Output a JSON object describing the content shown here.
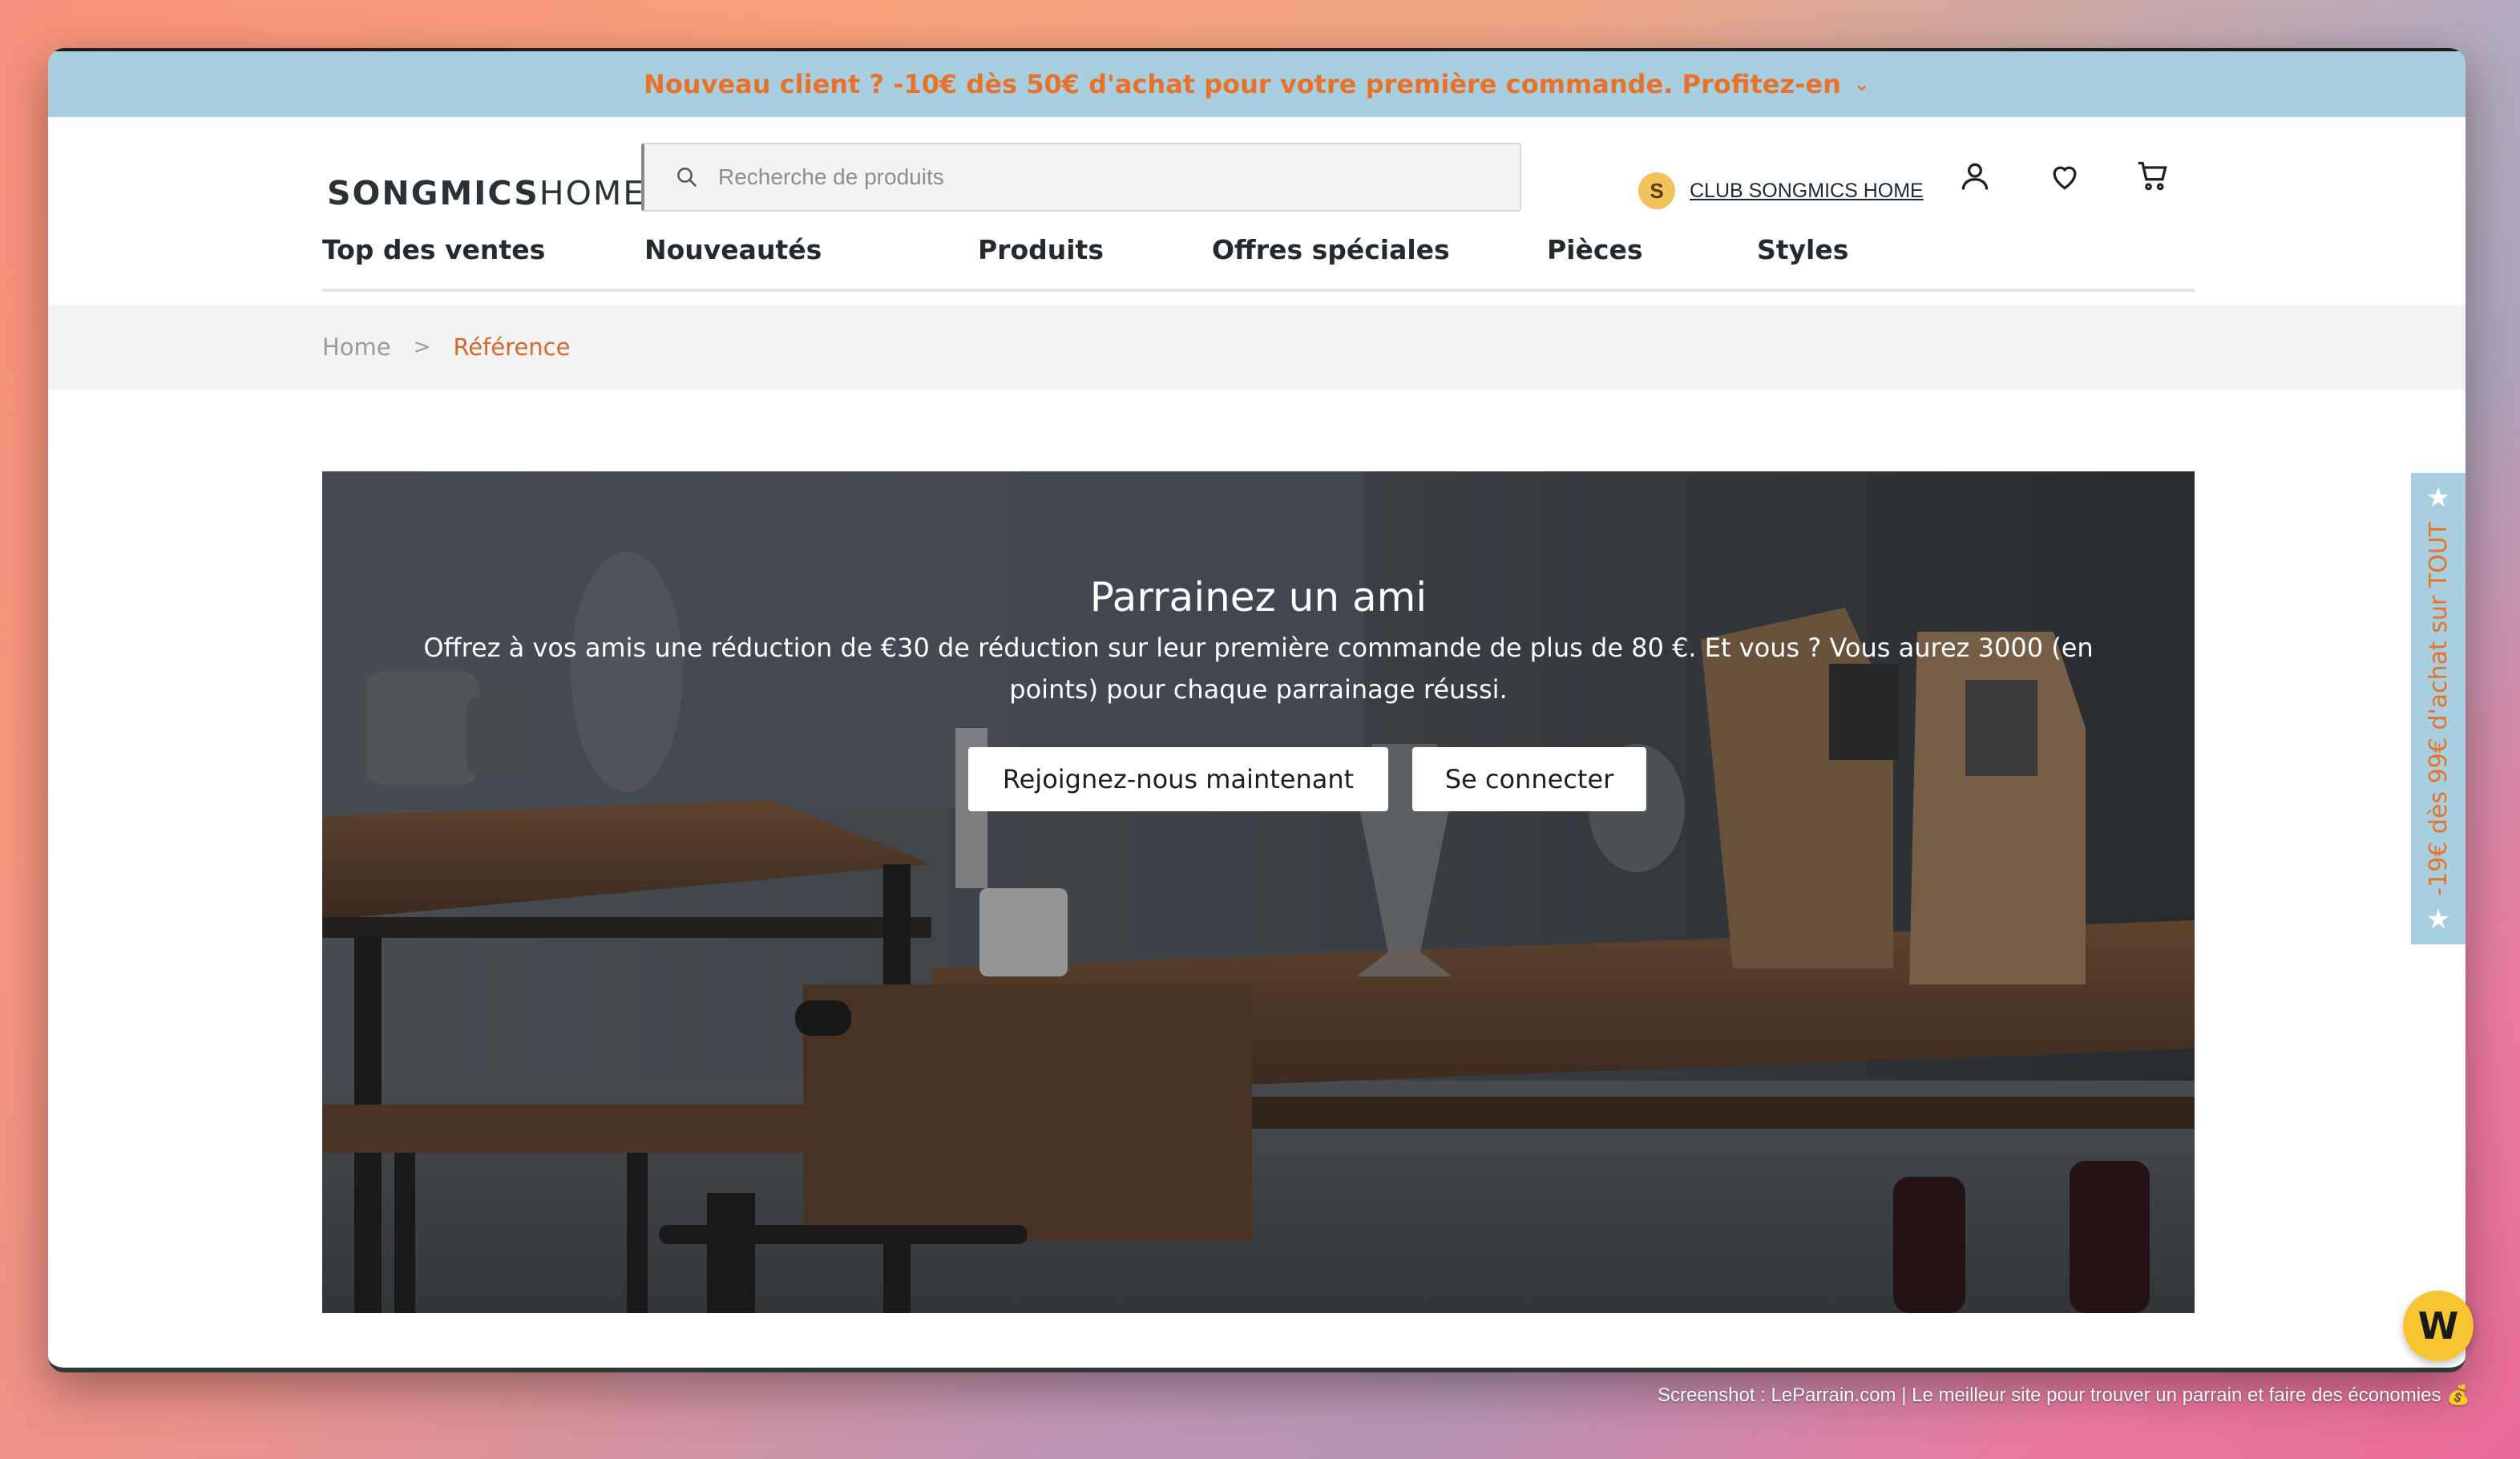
{
  "promo": {
    "text": "Nouveau client ? -10€ dès 50€ d'achat pour votre première commande. Profitez-en",
    "chevron": "chevron-down-icon"
  },
  "logo": {
    "bold": "SONGMICS",
    "light": "HOME"
  },
  "search": {
    "placeholder": "Recherche de produits",
    "value": ""
  },
  "club": {
    "badge": "S",
    "label": "CLUB SONGMICS HOME"
  },
  "header_icons": [
    "user-icon",
    "heart-icon",
    "cart-icon"
  ],
  "nav": {
    "items": [
      {
        "label": "Top des ventes"
      },
      {
        "label": "Nouveautés"
      },
      {
        "label": "Produits"
      },
      {
        "label": "Offres spéciales"
      },
      {
        "label": "Pièces"
      },
      {
        "label": "Styles"
      }
    ]
  },
  "breadcrumb": {
    "home": "Home",
    "separator": ">",
    "current": "Référence"
  },
  "hero": {
    "title": "Parrainez un ami",
    "text": "Offrez à vos amis une réduction de €30 de réduction sur leur première commande de plus de 80 €. Et vous ? Vous aurez 3000 (en points) pour chaque parrainage réussi.",
    "join_label": "Rejoignez-nous maintenant",
    "login_label": "Se connecter"
  },
  "side_tab": {
    "text": "-19€ dès 99€ d'achat sur TOUT"
  },
  "widget": {
    "letter": "W"
  },
  "footer_note": "Screenshot : LeParrain.com | Le meilleur site pour trouver un parrain et faire des économies 💰",
  "colors": {
    "accent_orange": "#e9722a",
    "promo_blue": "#a8cfe0",
    "text_dark": "#252a2e"
  }
}
